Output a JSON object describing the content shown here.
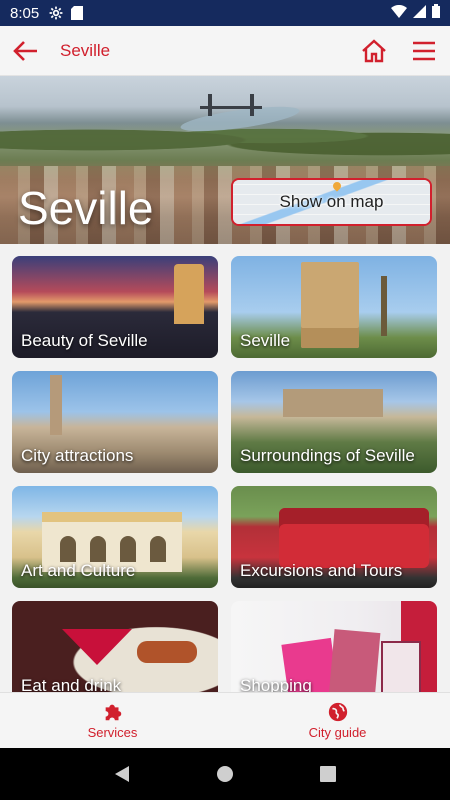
{
  "status_bar": {
    "time": "8:05"
  },
  "app_bar": {
    "title": "Seville"
  },
  "hero": {
    "city_title": "Seville",
    "map_button_label": "Show on map"
  },
  "cards": [
    {
      "label": "Beauty of Seville"
    },
    {
      "label": "Seville"
    },
    {
      "label": "City attractions"
    },
    {
      "label": "Surroundings of Seville"
    },
    {
      "label": "Art and Culture"
    },
    {
      "label": "Excursions and Tours"
    },
    {
      "label": "Eat and drink"
    },
    {
      "label": "Shopping"
    }
  ],
  "bottom_nav": {
    "services_label": "Services",
    "city_guide_label": "City guide"
  },
  "colors": {
    "accent": "#d1202d",
    "status_bar": "#152a5e",
    "app_bar": "#f5f5f5"
  },
  "icons": {
    "back": "arrow-left-icon",
    "home": "home-icon",
    "menu": "hamburger-menu-icon",
    "services": "puzzle-icon",
    "city_guide": "globe-icon"
  }
}
